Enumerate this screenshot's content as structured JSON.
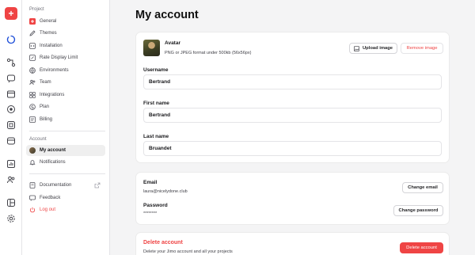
{
  "app": {
    "logo_glyph": "+",
    "accent": "#ef4444"
  },
  "rail": [
    {
      "icon": "loading-spinner-icon"
    },
    {
      "icon": "workflow-icon"
    },
    {
      "icon": "chat-icon"
    },
    {
      "icon": "window-icon"
    },
    {
      "icon": "target-icon"
    },
    {
      "icon": "grid-icon"
    },
    {
      "icon": "layers-icon"
    },
    {
      "icon": "analytics-icon"
    },
    {
      "icon": "users-icon"
    },
    {
      "icon": "layout-icon"
    },
    {
      "icon": "settings-icon"
    }
  ],
  "sidebar": {
    "project_label": "Project",
    "project_items": [
      {
        "label": "General",
        "icon": "brand-icon"
      },
      {
        "label": "Themes",
        "icon": "brush-icon"
      },
      {
        "label": "Installation",
        "icon": "code-icon"
      },
      {
        "label": "Rate Display Limit",
        "icon": "gauge-icon"
      },
      {
        "label": "Environments",
        "icon": "globe-icon"
      },
      {
        "label": "Team",
        "icon": "team-icon"
      },
      {
        "label": "Integrations",
        "icon": "puzzle-icon"
      },
      {
        "label": "Plan",
        "icon": "dollar-icon"
      },
      {
        "label": "Billing",
        "icon": "invoice-icon"
      }
    ],
    "account_label": "Account",
    "account_items": [
      {
        "label": "My account",
        "icon": "avatar"
      },
      {
        "label": "Notifications",
        "icon": "bell-icon"
      }
    ],
    "bottom_items": [
      {
        "label": "Documentation",
        "icon": "book-icon"
      },
      {
        "label": "Feedback",
        "icon": "feedback-icon"
      },
      {
        "label": "Log out",
        "icon": "logout-icon"
      }
    ]
  },
  "main": {
    "title": "My account",
    "avatar": {
      "label": "Avatar",
      "hint": "PNG or JPEG format under 500kb (56x56px)",
      "upload_label": "Upload image",
      "remove_label": "Remove image"
    },
    "username": {
      "label": "Username",
      "value": "Bertrand"
    },
    "first_name": {
      "label": "First name",
      "value": "Bertrand"
    },
    "last_name": {
      "label": "Last name",
      "value": "Bruandet"
    },
    "email": {
      "label": "Email",
      "value": "laura@nicelydone.club",
      "button": "Change email"
    },
    "password": {
      "label": "Password",
      "value": "********",
      "button": "Change password"
    },
    "delete": {
      "title": "Delete account",
      "description": "Delete your Jimo account and all your projects",
      "button": "Delete account"
    }
  }
}
